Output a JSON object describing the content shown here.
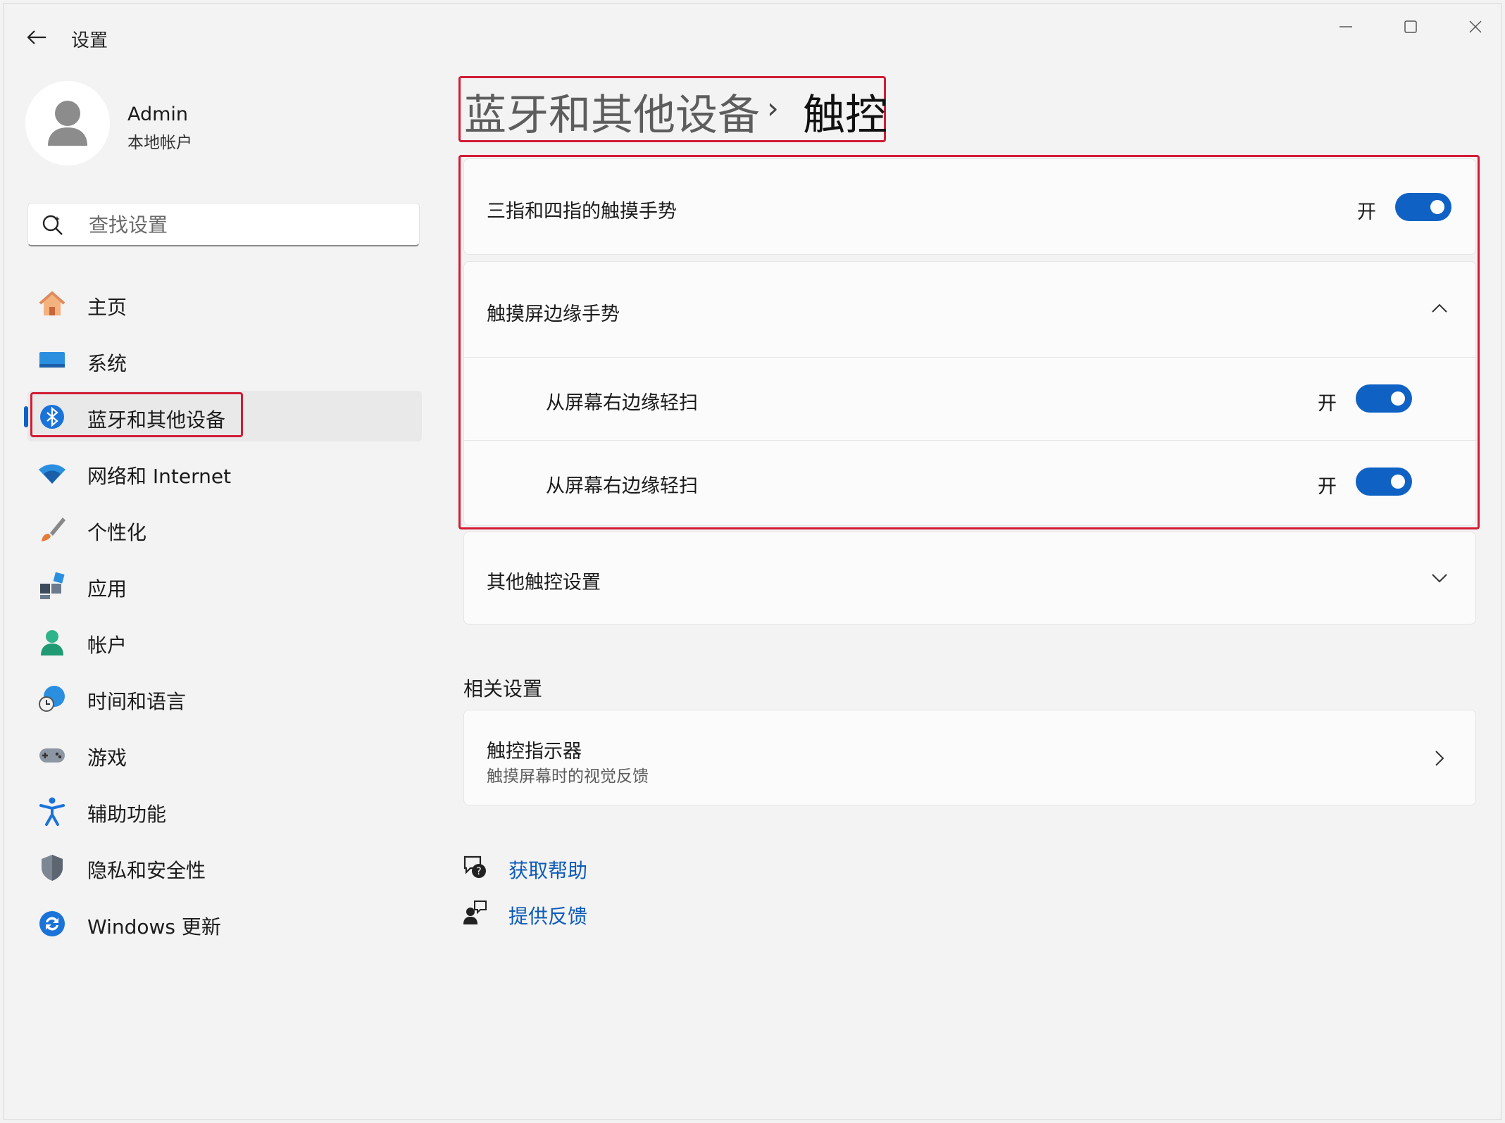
{
  "window": {
    "app_title": "设置"
  },
  "profile": {
    "name": "Admin",
    "account_type": "本地帐户"
  },
  "search": {
    "placeholder": "查找设置"
  },
  "nav": {
    "items": [
      {
        "label": "主页",
        "icon": "home-icon"
      },
      {
        "label": "系统",
        "icon": "system-icon"
      },
      {
        "label": "蓝牙和其他设备",
        "icon": "bluetooth-icon",
        "active": true
      },
      {
        "label": "网络和 Internet",
        "icon": "wifi-icon"
      },
      {
        "label": "个性化",
        "icon": "brush-icon"
      },
      {
        "label": "应用",
        "icon": "apps-icon"
      },
      {
        "label": "帐户",
        "icon": "account-icon"
      },
      {
        "label": "时间和语言",
        "icon": "globe-clock-icon"
      },
      {
        "label": "游戏",
        "icon": "gamepad-icon"
      },
      {
        "label": "辅助功能",
        "icon": "accessibility-icon"
      },
      {
        "label": "隐私和安全性",
        "icon": "shield-icon"
      },
      {
        "label": "Windows 更新",
        "icon": "update-icon"
      }
    ]
  },
  "header": {
    "parent": "蓝牙和其他设备",
    "separator": "›",
    "current": "触控"
  },
  "settings": {
    "three_four_finger": {
      "label": "三指和四指的触摸手势",
      "state": "开",
      "on": true
    },
    "edge_gestures": {
      "label": "触摸屏边缘手势",
      "expanded": true,
      "items": [
        {
          "label": "从屏幕右边缘轻扫",
          "state": "开",
          "on": true
        },
        {
          "label": "从屏幕右边缘轻扫",
          "state": "开",
          "on": true
        }
      ]
    },
    "other_touch": {
      "label": "其他触控设置",
      "expanded": false
    }
  },
  "related": {
    "title": "相关设置",
    "touch_indicator": {
      "label": "触控指示器",
      "description": "触摸屏幕时的视觉反馈"
    }
  },
  "links": {
    "help": "获取帮助",
    "feedback": "提供反馈"
  },
  "colors": {
    "accent": "#0f62c4",
    "highlight_box": "#d21c35",
    "link": "#0e5bb8",
    "background": "#f3f3f3"
  }
}
